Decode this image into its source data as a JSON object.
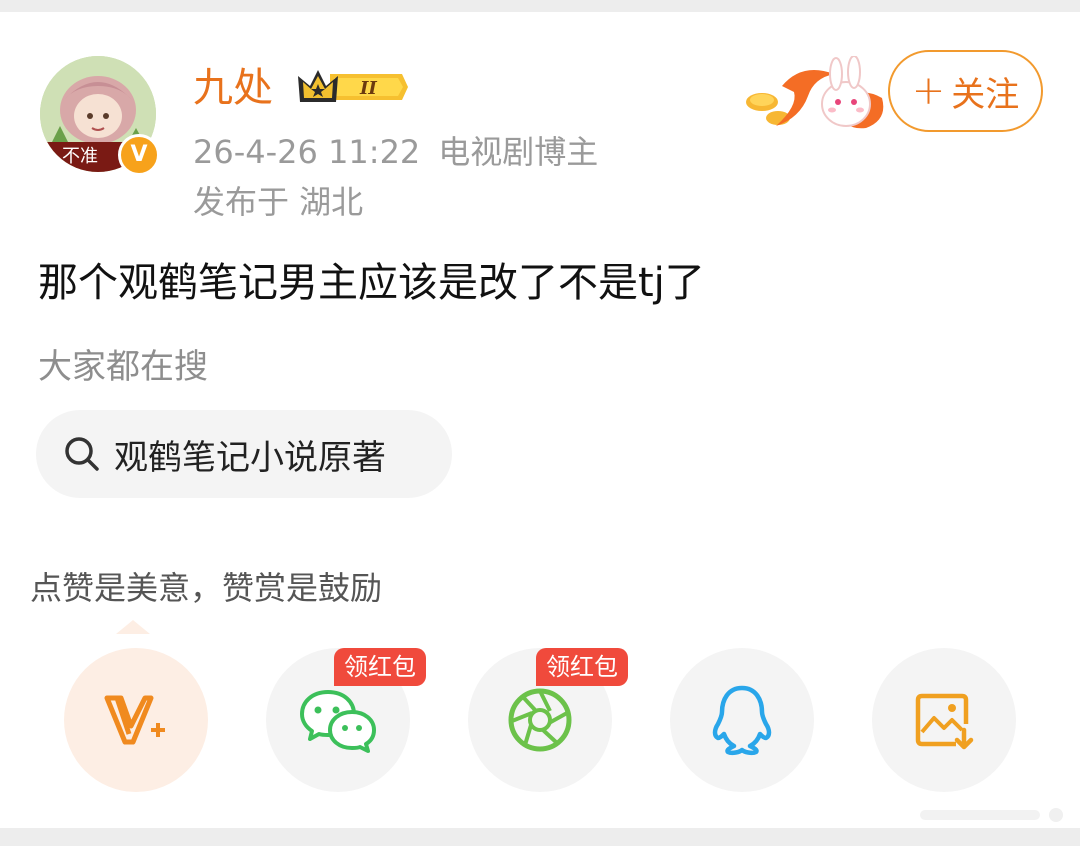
{
  "post": {
    "author": {
      "name": "九处",
      "avatar_caption": "不准",
      "verified_mark": "V",
      "level_mark": "II"
    },
    "timestamp": "26-4-26 11:22",
    "role": "电视剧博主",
    "location": "发布于 湖北",
    "follow_label": "关注",
    "follow_plus": "+",
    "body": "那个观鹤笔记男主应该是改了不是tj了"
  },
  "search": {
    "title": "大家都在搜",
    "chip_text": "观鹤笔记小说原著"
  },
  "reward": {
    "text": "点赞是美意，赞赏是鼓励"
  },
  "share": {
    "items": [
      {
        "id": "reward-v-plus",
        "icon": "v-plus-icon"
      },
      {
        "id": "wechat",
        "icon": "wechat-icon",
        "tag": "领红包"
      },
      {
        "id": "moments",
        "icon": "moments-icon",
        "tag": "领红包"
      },
      {
        "id": "qq",
        "icon": "qq-icon"
      },
      {
        "id": "save-image",
        "icon": "save-image-icon"
      }
    ]
  },
  "colors": {
    "accent_orange": "#e8721c",
    "wechat_green": "#3cc05a",
    "qq_blue": "#29a6ea",
    "tag_red": "#f04a3c"
  }
}
